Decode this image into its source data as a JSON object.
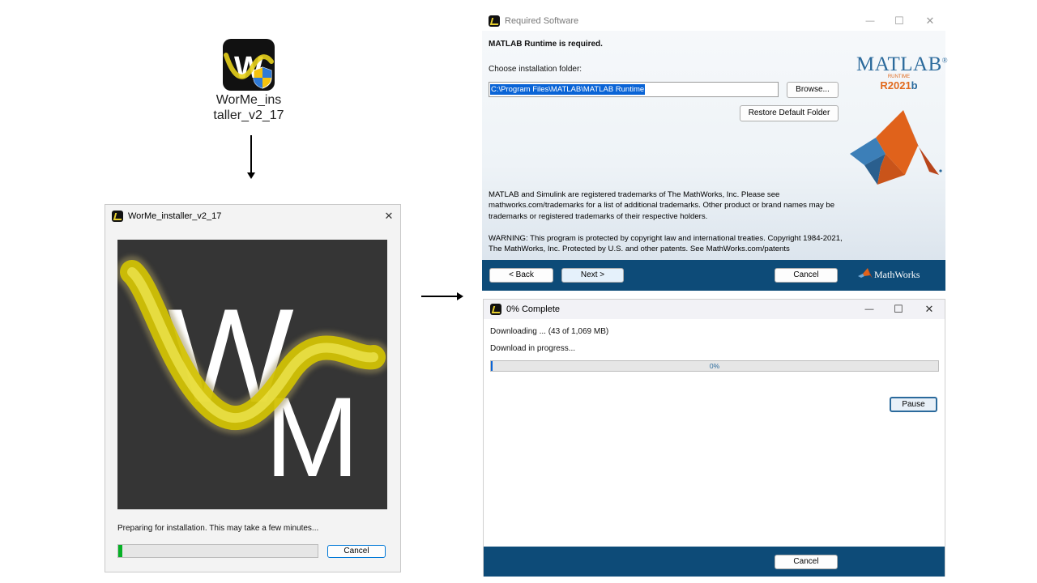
{
  "desktop_icon": {
    "label_line1": "WorMe_ins",
    "label_line2": "taller_v2_17"
  },
  "installer": {
    "title": "WorMe_installer_v2_17",
    "splash_letter_w": "W",
    "splash_letter_m": "M",
    "status": "Preparing for installation. This may take a few minutes...",
    "progress": 0.02,
    "cancel_label": "Cancel"
  },
  "required_software": {
    "title": "Required Software",
    "heading": "MATLAB Runtime is required.",
    "folder_label": "Choose installation folder:",
    "folder_value": "C:\\Program Files\\MATLAB\\MATLAB Runtime",
    "browse_label": "Browse...",
    "restore_label": "Restore Default Folder",
    "brand": "MATLAB",
    "brand_reg": "®",
    "runtime_label": "RUNTIME",
    "version_r": "R2021",
    "version_b": "b",
    "trademark_text": "MATLAB and Simulink are registered trademarks of The MathWorks, Inc.   Please see mathworks.com/trademarks for a list of additional trademarks. Other product or brand names may be trademarks or registered trademarks of their respective holders.",
    "warning_text": "WARNING: This program is protected by copyright law and international treaties. Copyright 1984-2021, The MathWorks, Inc. Protected by U.S. and other patents. See MathWorks.com/patents",
    "back_label": "< Back",
    "next_label": "Next >",
    "cancel_label": "Cancel",
    "mathworks_label": "MathWorks",
    "colors": {
      "footer": "#0d4b78",
      "matlab_blue": "#2b6a9c",
      "matlab_orange": "#e16a1e"
    }
  },
  "download": {
    "title": "0% Complete",
    "downloading_text": "Downloading ... (43 of 1,069 MB)",
    "progress_label": "Download in progress...",
    "percent_text": "0%",
    "progress": 0.0,
    "pause_label": "Pause",
    "cancel_label": "Cancel"
  },
  "window_controls": {
    "minimize": "—",
    "maximize": "☐",
    "close": "✕"
  }
}
